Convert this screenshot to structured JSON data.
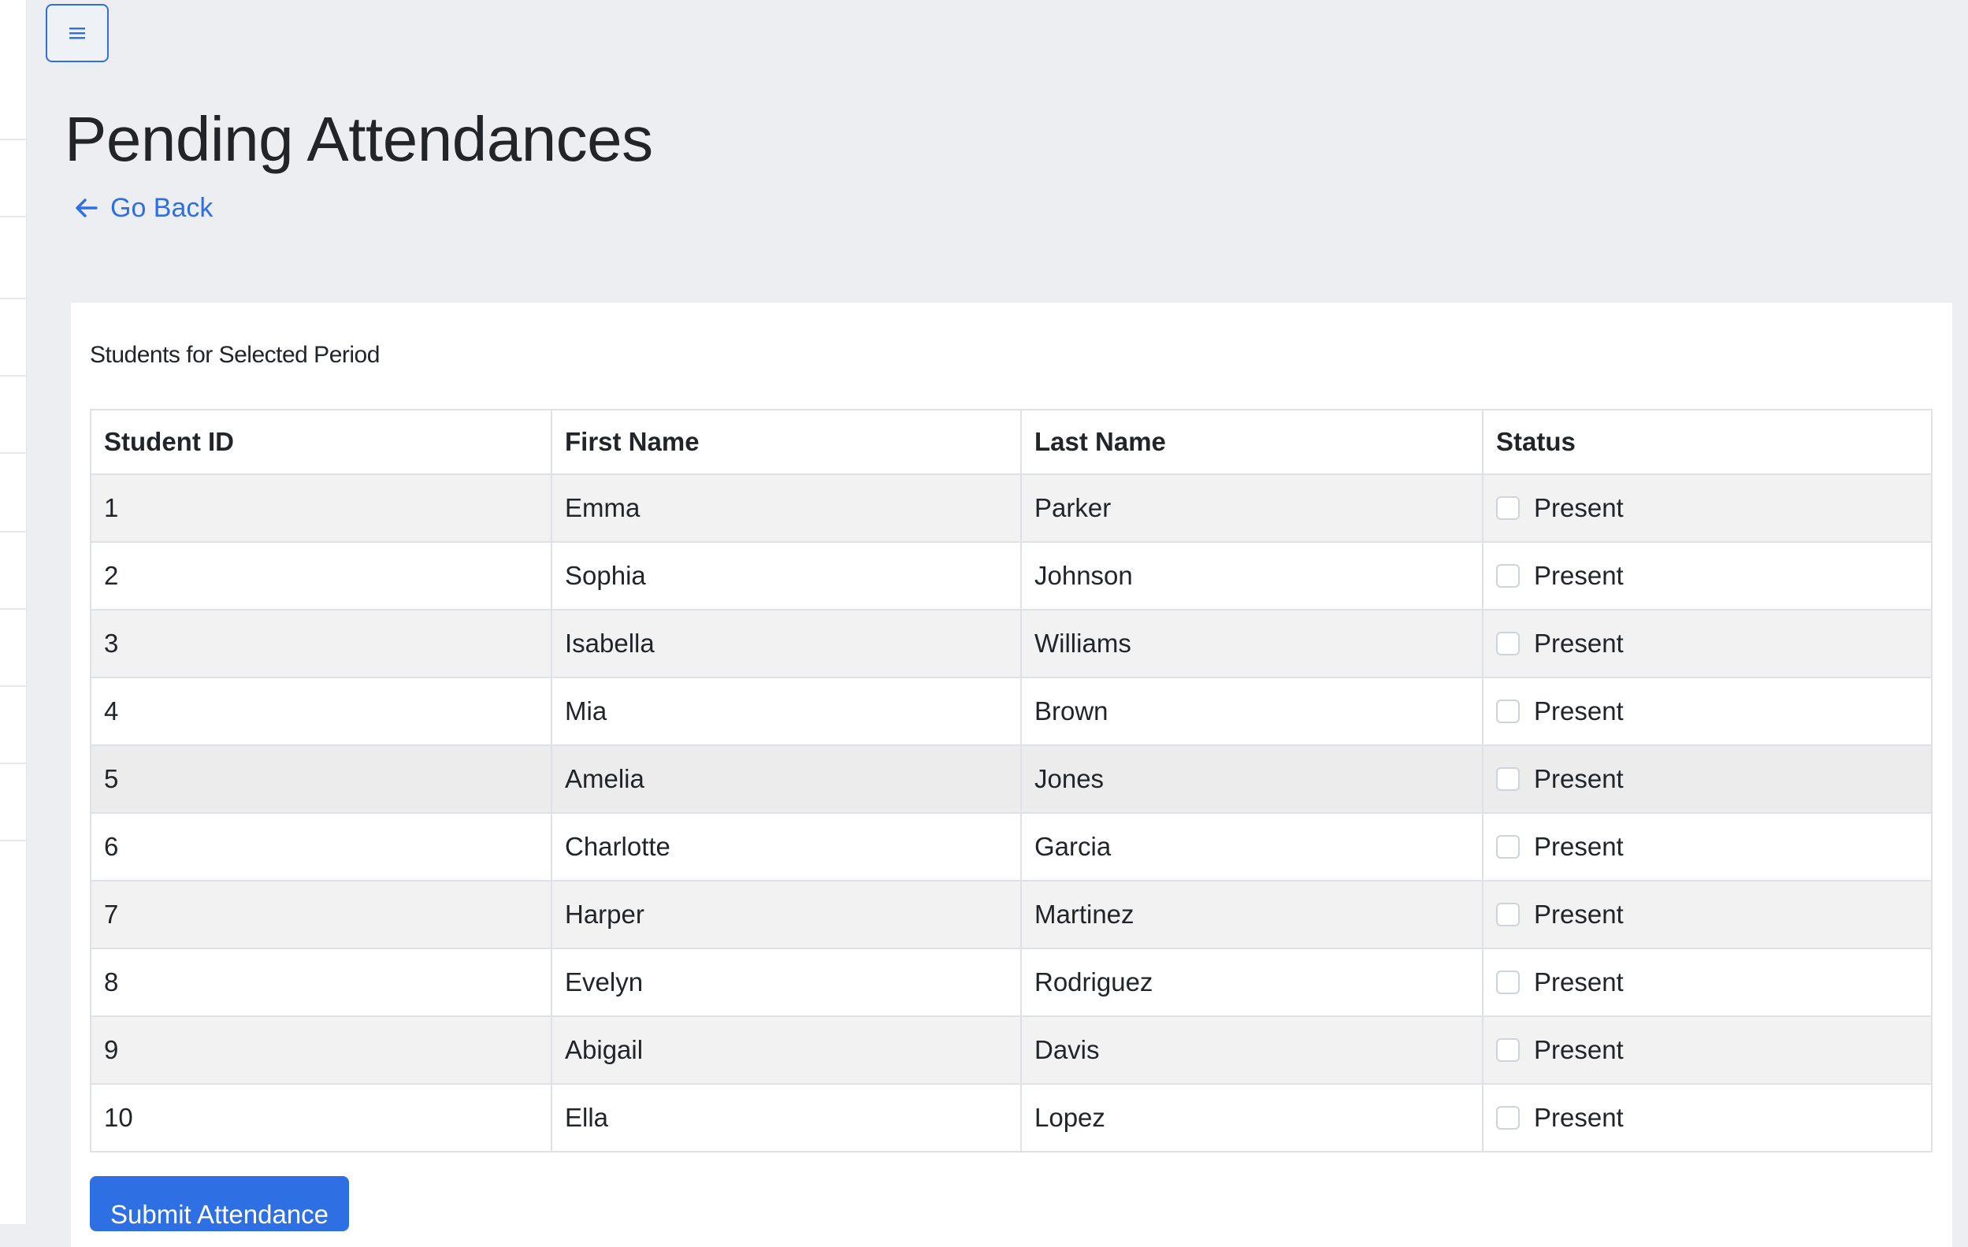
{
  "header": {
    "menu_icon": "hamburger-menu-icon",
    "title": "Pending Attendances",
    "back_link": "Go Back",
    "back_icon": "arrow-left-icon"
  },
  "card": {
    "title": "Students for Selected Period",
    "columns": [
      "Student ID",
      "First Name",
      "Last Name",
      "Status"
    ],
    "rows": [
      {
        "id": "1",
        "first": "Emma",
        "last": "Parker",
        "status": "Present",
        "checked": false
      },
      {
        "id": "2",
        "first": "Sophia",
        "last": "Johnson",
        "status": "Present",
        "checked": false
      },
      {
        "id": "3",
        "first": "Isabella",
        "last": "Williams",
        "status": "Present",
        "checked": false
      },
      {
        "id": "4",
        "first": "Mia",
        "last": "Brown",
        "status": "Present",
        "checked": false
      },
      {
        "id": "5",
        "first": "Amelia",
        "last": "Jones",
        "status": "Present",
        "checked": false
      },
      {
        "id": "6",
        "first": "Charlotte",
        "last": "Garcia",
        "status": "Present",
        "checked": false
      },
      {
        "id": "7",
        "first": "Harper",
        "last": "Martinez",
        "status": "Present",
        "checked": false
      },
      {
        "id": "8",
        "first": "Evelyn",
        "last": "Rodriguez",
        "status": "Present",
        "checked": false
      },
      {
        "id": "9",
        "first": "Abigail",
        "last": "Davis",
        "status": "Present",
        "checked": false
      },
      {
        "id": "10",
        "first": "Ella",
        "last": "Lopez",
        "status": "Present",
        "checked": false
      }
    ],
    "submit_label": "Submit Attendance"
  },
  "colors": {
    "accent": "#2f6fe4",
    "page_bg": "#eceef1",
    "stripe": "#f2f2f2"
  }
}
